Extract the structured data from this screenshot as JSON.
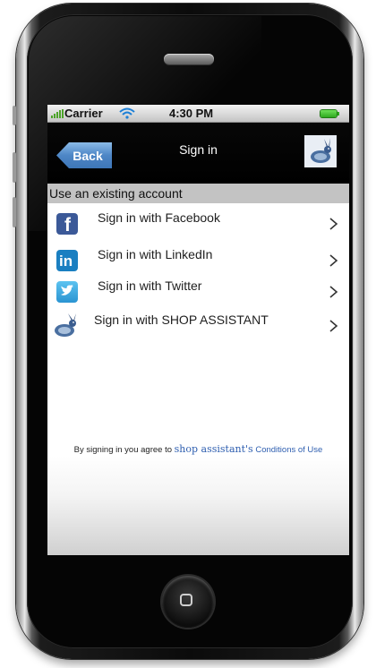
{
  "status_bar": {
    "carrier": "Carrier",
    "time": "4:30 PM"
  },
  "nav": {
    "back_label": "Back",
    "title": "Sign in"
  },
  "section": {
    "header": "Use an existing account"
  },
  "sign_in_options": [
    {
      "label": "Sign in with Facebook",
      "icon": "facebook-icon",
      "color": "#3b5998"
    },
    {
      "label": "Sign in with LinkedIn",
      "icon": "linkedin-icon",
      "color": "#1a7fc1"
    },
    {
      "label": "Sign in with Twitter",
      "icon": "twitter-icon",
      "color": "#3aa8e0"
    },
    {
      "label": "Sign in with SHOP ASSISTANT",
      "icon": "shop-assistant-rabbit-icon",
      "color": "#3a5c8f"
    }
  ],
  "footer": {
    "prefix": "By signing in you agree to",
    "brand": "shop assistant's",
    "link": "Conditions of Use"
  },
  "colors": {
    "accent_blue": "#4d86c6",
    "battery_green": "#2ea81e",
    "link_blue": "#2f5fb0"
  }
}
